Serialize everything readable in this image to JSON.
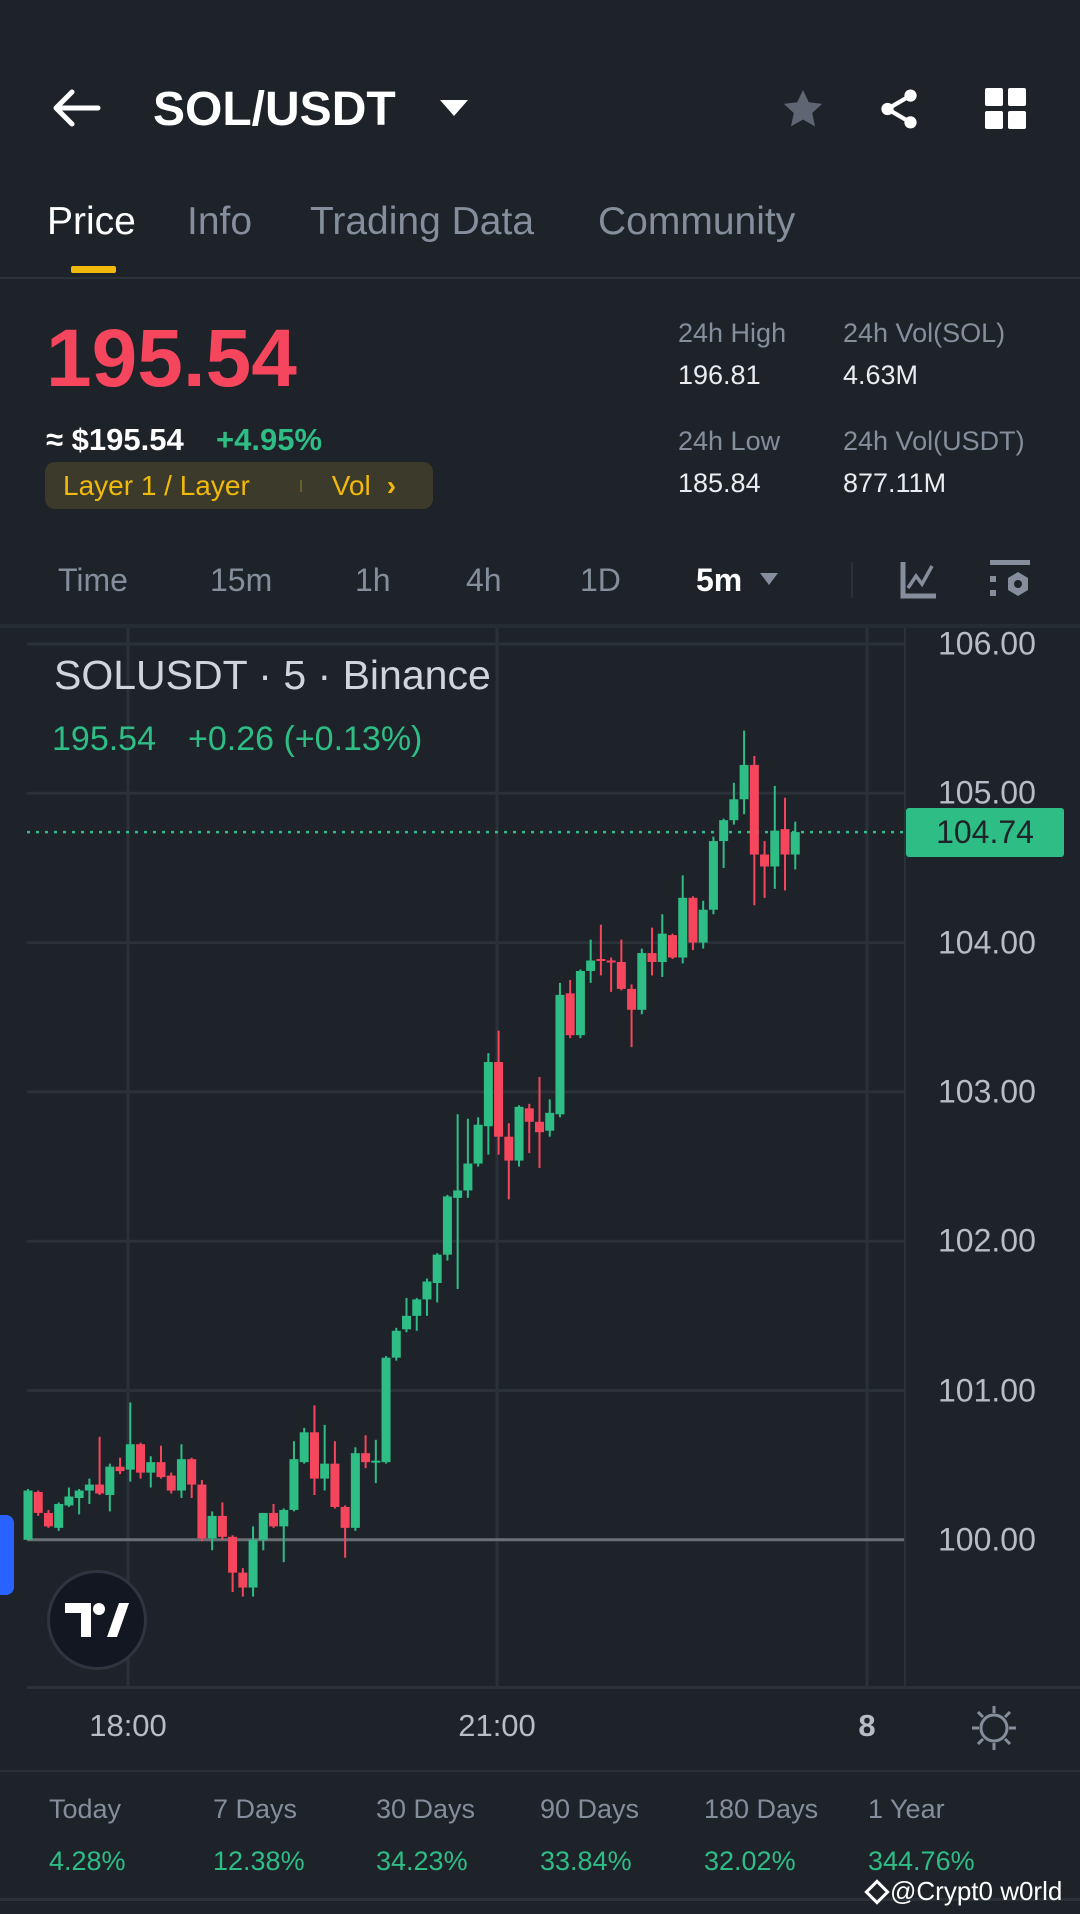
{
  "header": {
    "title": "SOL/USDT"
  },
  "tabs": [
    {
      "label": "Price"
    },
    {
      "label": "Info"
    },
    {
      "label": "Trading Data"
    },
    {
      "label": "Community"
    }
  ],
  "price": {
    "last": "195.54",
    "approx": "≈ $195.54",
    "change": "+4.95%",
    "tag_label": "Layer 1 / Layer",
    "tag_vol": "Vol"
  },
  "stats": {
    "high_label": "24h High",
    "high": "196.81",
    "vol_sol_label": "24h Vol(SOL)",
    "vol_sol": "4.63M",
    "low_label": "24h Low",
    "low": "185.84",
    "vol_usdt_label": "24h Vol(USDT)",
    "vol_usdt": "877.11M"
  },
  "intervals": [
    {
      "label": "Time"
    },
    {
      "label": "15m"
    },
    {
      "label": "1h"
    },
    {
      "label": "4h"
    },
    {
      "label": "1D"
    },
    {
      "label": "5m"
    }
  ],
  "chart_overlay": {
    "symbol": "SOLUSDT · 5 · Binance",
    "last": "195.54",
    "change": "+0.26 (+0.13%)",
    "current_tag": "104.74"
  },
  "colors": {
    "up": "#2ebd85",
    "down": "#f6465d",
    "accent": "#f0b90b",
    "bg": "#1e2329"
  },
  "chart_data": {
    "type": "candlestick",
    "ylim": [
      99.3,
      106.1
    ],
    "y_ticks": [
      "106.00",
      "105.00",
      "104.00",
      "103.00",
      "102.00",
      "101.00",
      "100.00"
    ],
    "x_ticks": [
      "18:00",
      "21:00",
      "8"
    ],
    "current_price": 104.74,
    "ohlc": [
      [
        100.0,
        100.34,
        100.0,
        100.33
      ],
      [
        100.32,
        100.33,
        100.16,
        100.18
      ],
      [
        100.18,
        100.2,
        100.08,
        100.09
      ],
      [
        100.08,
        100.25,
        100.06,
        100.24
      ],
      [
        100.23,
        100.35,
        100.22,
        100.29
      ],
      [
        100.28,
        100.34,
        100.17,
        100.33
      ],
      [
        100.33,
        100.41,
        100.24,
        100.37
      ],
      [
        100.37,
        100.69,
        100.3,
        100.31
      ],
      [
        100.3,
        100.51,
        100.19,
        100.49
      ],
      [
        100.49,
        100.55,
        100.44,
        100.46
      ],
      [
        100.47,
        100.92,
        100.39,
        100.64
      ],
      [
        100.64,
        100.65,
        100.41,
        100.45
      ],
      [
        100.45,
        100.56,
        100.35,
        100.52
      ],
      [
        100.52,
        100.63,
        100.41,
        100.42
      ],
      [
        100.43,
        100.45,
        100.31,
        100.33
      ],
      [
        100.33,
        100.64,
        100.28,
        100.54
      ],
      [
        100.54,
        100.55,
        100.28,
        100.37
      ],
      [
        100.37,
        100.4,
        99.99,
        100.01
      ],
      [
        100.01,
        100.19,
        99.93,
        100.16
      ],
      [
        100.16,
        100.25,
        100.0,
        100.02
      ],
      [
        100.02,
        100.03,
        99.65,
        99.78
      ],
      [
        99.78,
        99.81,
        99.62,
        99.68
      ],
      [
        99.68,
        100.09,
        99.62,
        100.0
      ],
      [
        100.0,
        100.18,
        99.93,
        100.18
      ],
      [
        100.18,
        100.24,
        100.08,
        100.09
      ],
      [
        100.09,
        100.21,
        99.85,
        100.2
      ],
      [
        100.2,
        100.66,
        100.19,
        100.54
      ],
      [
        100.52,
        100.75,
        100.51,
        100.72
      ],
      [
        100.72,
        100.9,
        100.3,
        100.41
      ],
      [
        100.41,
        100.77,
        100.33,
        100.51
      ],
      [
        100.51,
        100.66,
        100.21,
        100.22
      ],
      [
        100.22,
        100.23,
        99.88,
        100.08
      ],
      [
        100.08,
        100.62,
        100.06,
        100.58
      ],
      [
        100.58,
        100.7,
        100.48,
        100.52
      ],
      [
        100.53,
        100.67,
        100.38,
        100.53
      ],
      [
        100.52,
        101.23,
        100.51,
        101.22
      ],
      [
        101.22,
        101.42,
        101.2,
        101.4
      ],
      [
        101.41,
        101.62,
        101.39,
        101.5
      ],
      [
        101.5,
        101.62,
        101.4,
        101.61
      ],
      [
        101.61,
        101.75,
        101.5,
        101.73
      ],
      [
        101.72,
        101.92,
        101.59,
        101.91
      ],
      [
        101.91,
        102.31,
        101.87,
        102.3
      ],
      [
        102.29,
        102.85,
        101.68,
        102.34
      ],
      [
        102.34,
        102.82,
        102.29,
        102.52
      ],
      [
        102.52,
        102.83,
        102.5,
        102.78
      ],
      [
        102.77,
        103.26,
        102.58,
        103.2
      ],
      [
        103.2,
        103.41,
        102.58,
        102.7
      ],
      [
        102.7,
        102.79,
        102.28,
        102.54
      ],
      [
        102.54,
        102.91,
        102.5,
        102.9
      ],
      [
        102.89,
        102.92,
        102.59,
        102.8
      ],
      [
        102.8,
        103.1,
        102.49,
        102.73
      ],
      [
        102.74,
        102.95,
        102.7,
        102.86
      ],
      [
        102.85,
        103.73,
        102.83,
        103.65
      ],
      [
        103.66,
        103.75,
        103.36,
        103.38
      ],
      [
        103.38,
        103.82,
        103.36,
        103.81
      ],
      [
        103.81,
        104.02,
        103.73,
        103.88
      ],
      [
        103.89,
        104.12,
        103.78,
        103.88
      ],
      [
        103.88,
        103.9,
        103.67,
        103.87
      ],
      [
        103.87,
        104.02,
        103.68,
        103.69
      ],
      [
        103.69,
        103.72,
        103.3,
        103.55
      ],
      [
        103.55,
        103.96,
        103.52,
        103.93
      ],
      [
        103.93,
        104.1,
        103.78,
        103.87
      ],
      [
        103.87,
        104.19,
        103.77,
        104.06
      ],
      [
        104.05,
        104.06,
        103.89,
        103.9
      ],
      [
        103.9,
        104.45,
        103.86,
        104.3
      ],
      [
        104.3,
        104.31,
        103.95,
        104.0
      ],
      [
        104.0,
        104.28,
        103.96,
        104.22
      ],
      [
        104.22,
        104.71,
        104.19,
        104.68
      ],
      [
        104.68,
        104.83,
        104.5,
        104.82
      ],
      [
        104.82,
        105.07,
        104.79,
        104.96
      ],
      [
        104.96,
        105.42,
        104.86,
        105.19
      ],
      [
        105.19,
        105.25,
        104.25,
        104.59
      ],
      [
        104.59,
        104.68,
        104.3,
        104.51
      ],
      [
        104.51,
        105.05,
        104.36,
        104.75
      ],
      [
        104.76,
        104.97,
        104.35,
        104.59
      ],
      [
        104.59,
        104.81,
        104.49,
        104.74
      ]
    ]
  },
  "performance": [
    {
      "label": "Today",
      "value": "4.28%"
    },
    {
      "label": "7 Days",
      "value": "12.38%"
    },
    {
      "label": "30 Days",
      "value": "34.23%"
    },
    {
      "label": "90 Days",
      "value": "33.84%"
    },
    {
      "label": "180 Days",
      "value": "32.02%"
    },
    {
      "label": "1 Year",
      "value": "344.76%"
    }
  ],
  "watermark": "@Crypt0 w0rld"
}
